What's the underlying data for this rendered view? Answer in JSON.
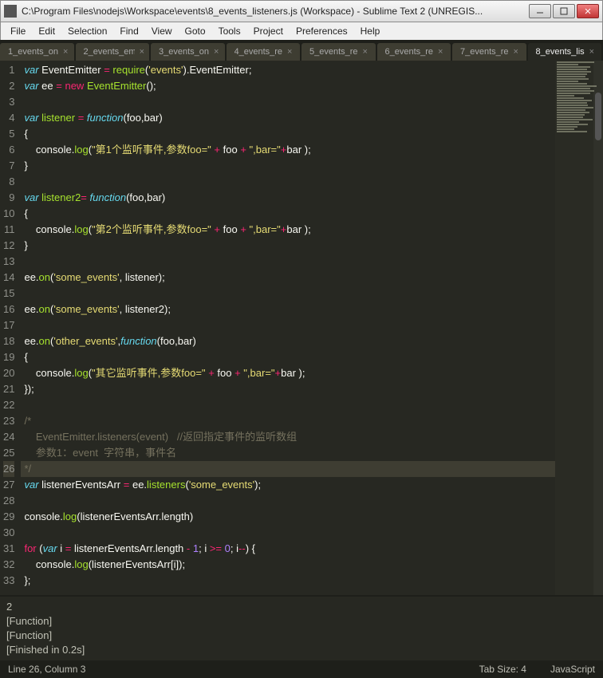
{
  "window": {
    "title": "C:\\Program Files\\nodejs\\Workspace\\events\\8_events_listeners.js (Workspace) - Sublime Text 2 (UNREGIS..."
  },
  "menu": {
    "items": [
      "File",
      "Edit",
      "Selection",
      "Find",
      "View",
      "Goto",
      "Tools",
      "Project",
      "Preferences",
      "Help"
    ]
  },
  "tabs": {
    "items": [
      {
        "label": "1_events_on",
        "active": false
      },
      {
        "label": "2_events_em",
        "active": false
      },
      {
        "label": "3_events_on",
        "active": false
      },
      {
        "label": "4_events_re",
        "active": false
      },
      {
        "label": "5_events_re",
        "active": false
      },
      {
        "label": "6_events_re",
        "active": false
      },
      {
        "label": "7_events_re",
        "active": false
      },
      {
        "label": "8_events_lis",
        "active": true
      }
    ]
  },
  "editor": {
    "current_line": 26,
    "lines": [
      {
        "n": 1,
        "html": "<span class='st'>var</span> <span class='pn'>EventEmitter</span> <span class='op'>=</span> <span class='fn'>require</span>(<span class='str'>'events'</span>).EventEmitter;"
      },
      {
        "n": 2,
        "html": "<span class='st'>var</span> <span class='pn'>ee</span> <span class='op'>=</span> <span class='op'>new</span> <span class='fn'>EventEmitter</span>();"
      },
      {
        "n": 3,
        "html": ""
      },
      {
        "n": 4,
        "html": "<span class='st'>var</span> <span class='fn'>listener</span> <span class='op'>=</span> <span class='st'>function</span>(<span class='pn'>foo</span>,<span class='pn'>bar</span>)"
      },
      {
        "n": 5,
        "html": "{"
      },
      {
        "n": 6,
        "html": "    console.<span class='fn'>log</span>(<span class='str'>\"第1个监听事件,参数foo=\"</span> <span class='op'>+</span> foo <span class='op'>+</span> <span class='str'>\",bar=\"</span><span class='op'>+</span>bar );"
      },
      {
        "n": 7,
        "html": "}"
      },
      {
        "n": 8,
        "html": ""
      },
      {
        "n": 9,
        "html": "<span class='st'>var</span> <span class='fn'>listener2</span><span class='op'>=</span> <span class='st'>function</span>(<span class='pn'>foo</span>,<span class='pn'>bar</span>)"
      },
      {
        "n": 10,
        "html": "{"
      },
      {
        "n": 11,
        "html": "    console.<span class='fn'>log</span>(<span class='str'>\"第2个监听事件,参数foo=\"</span> <span class='op'>+</span> foo <span class='op'>+</span> <span class='str'>\",bar=\"</span><span class='op'>+</span>bar );"
      },
      {
        "n": 12,
        "html": "}"
      },
      {
        "n": 13,
        "html": ""
      },
      {
        "n": 14,
        "html": "ee.<span class='fn'>on</span>(<span class='str'>'some_events'</span>, listener);"
      },
      {
        "n": 15,
        "html": ""
      },
      {
        "n": 16,
        "html": "ee.<span class='fn'>on</span>(<span class='str'>'some_events'</span>, listener2);"
      },
      {
        "n": 17,
        "html": ""
      },
      {
        "n": 18,
        "html": "ee.<span class='fn'>on</span>(<span class='str'>'other_events'</span>,<span class='st'>function</span>(<span class='pn'>foo</span>,<span class='pn'>bar</span>)"
      },
      {
        "n": 19,
        "html": "{"
      },
      {
        "n": 20,
        "html": "    console.<span class='fn'>log</span>(<span class='str'>\"其它监听事件,参数foo=\"</span> <span class='op'>+</span> foo <span class='op'>+</span> <span class='str'>\",bar=\"</span><span class='op'>+</span>bar );"
      },
      {
        "n": 21,
        "html": "});"
      },
      {
        "n": 22,
        "html": ""
      },
      {
        "n": 23,
        "html": "<span class='cm'>/*</span>"
      },
      {
        "n": 24,
        "html": "<span class='cm'>    EventEmitter.listeners(event)   //返回指定事件的监听数组</span>"
      },
      {
        "n": 25,
        "html": "<span class='cm'>    参数1：event  字符串，事件名</span>"
      },
      {
        "n": 26,
        "html": "<span class='cm'>*/</span>"
      },
      {
        "n": 27,
        "html": "<span class='st'>var</span> <span class='pn'>listenerEventsArr</span> <span class='op'>=</span> ee.<span class='fn'>listeners</span>(<span class='str'>'some_events'</span>);"
      },
      {
        "n": 28,
        "html": ""
      },
      {
        "n": 29,
        "html": "console.<span class='fn'>log</span>(listenerEventsArr.length)"
      },
      {
        "n": 30,
        "html": ""
      },
      {
        "n": 31,
        "html": "<span class='op'>for</span> (<span class='st'>var</span> i <span class='op'>=</span> listenerEventsArr.length <span class='op'>-</span> <span class='num'>1</span>; i <span class='op'>&gt;=</span> <span class='num'>0</span>; i<span class='op'>--</span>) {"
      },
      {
        "n": 32,
        "html": "    console.<span class='fn'>log</span>(listenerEventsArr[i]);"
      },
      {
        "n": 33,
        "html": "};"
      }
    ]
  },
  "console": {
    "lines": [
      "2",
      "[Function]",
      "[Function]",
      "[Finished in 0.2s]"
    ]
  },
  "status": {
    "left": "Line 26, Column 3",
    "tab_size": "Tab Size: 4",
    "lang": "JavaScript"
  }
}
